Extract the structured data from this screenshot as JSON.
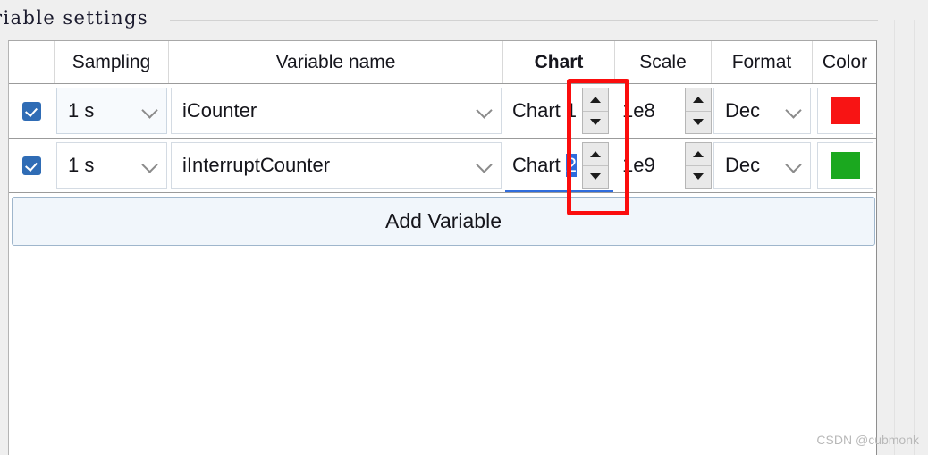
{
  "window": {
    "group_title": "riable settings",
    "watermark": "CSDN @cubmonk"
  },
  "table": {
    "headers": {
      "checkbox": "",
      "sampling": "Sampling",
      "variable_name": "Variable name",
      "chart": "Chart",
      "scale": "Scale",
      "format": "Format",
      "color": "Color"
    },
    "rows": [
      {
        "enabled": true,
        "sampling": "1 s",
        "variable_name": "iCounter",
        "chart_label": "Chart",
        "chart_number": "1",
        "chart_number_selected": false,
        "scale": "1e8",
        "format": "Dec",
        "color": "#f81414",
        "color_name": "red"
      },
      {
        "enabled": true,
        "sampling": "1 s",
        "variable_name": "iInterruptCounter",
        "chart_label": "Chart",
        "chart_number": "2",
        "chart_number_selected": true,
        "scale": "1e9",
        "format": "Dec",
        "color": "#1ba81f",
        "color_name": "green"
      }
    ]
  },
  "actions": {
    "add_variable_label": "Add Variable"
  },
  "annotation": {
    "color": "#fb0d0d",
    "target": "chart-number-spinner"
  },
  "icons": {
    "chevron_down": "chevron-down-icon",
    "spinner_up": "triangle-up-icon",
    "spinner_down": "triangle-down-icon",
    "checkmark": "check-icon"
  }
}
